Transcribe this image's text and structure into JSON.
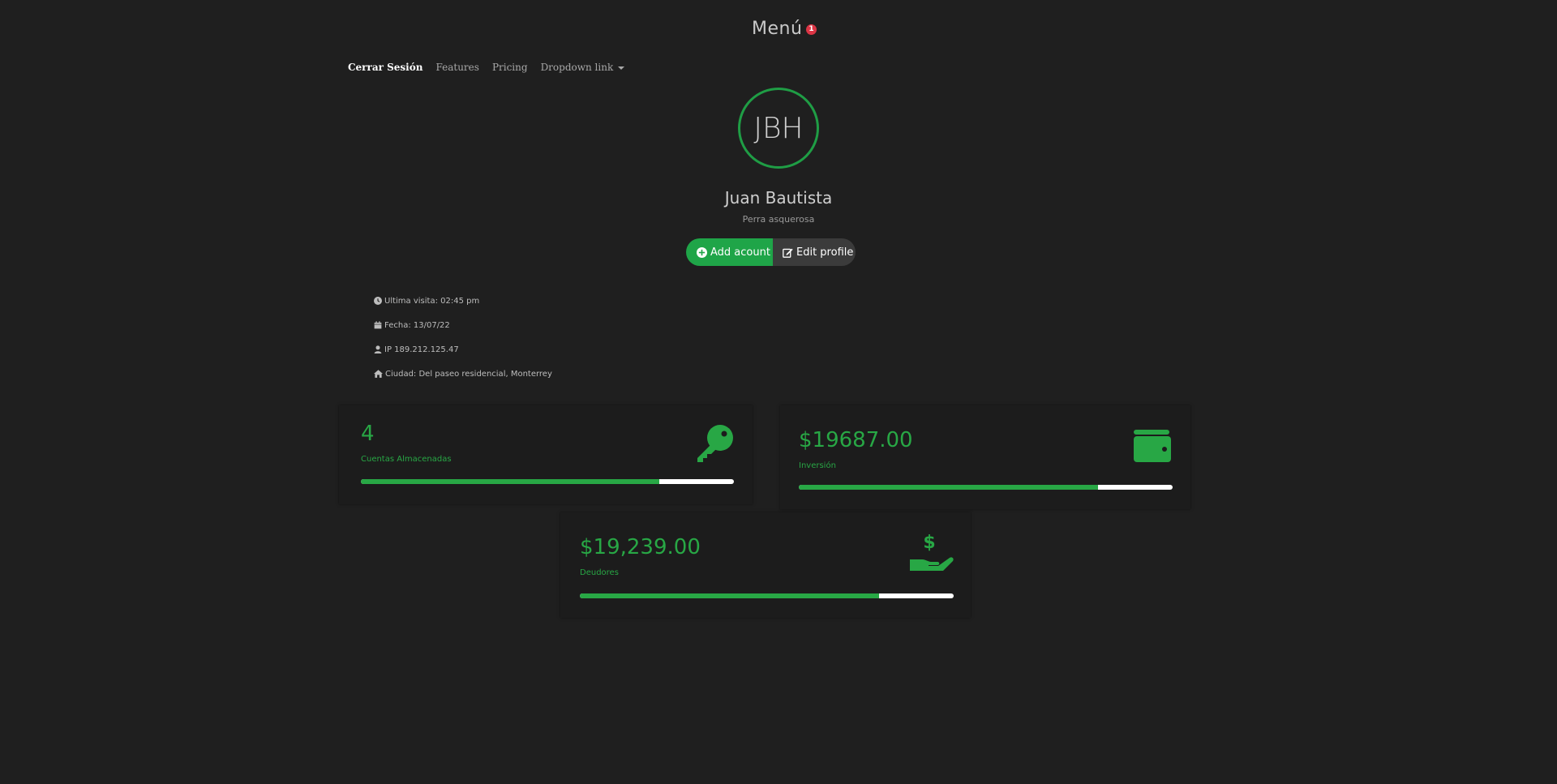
{
  "header": {
    "menu_title": "Menú",
    "notification_count": "1"
  },
  "nav": {
    "items": [
      {
        "label": "Cerrar Sesión"
      },
      {
        "label": "Features"
      },
      {
        "label": "Pricing"
      },
      {
        "label": "Dropdown link"
      }
    ]
  },
  "profile": {
    "initials": "JBH",
    "name": "Juan Bautista",
    "subtitle": "Perra asquerosa",
    "add_label": "Add acount",
    "edit_label": "Edit profile"
  },
  "info": {
    "last_visit": "Ultima visita: 02:45 pm",
    "date": "Fecha: 13/07/22",
    "ip": "IP 189.212.125.47",
    "city": "Ciudad: Del paseo residencial, Monterrey"
  },
  "stats": [
    {
      "value": "4",
      "label": "Cuentas Almacenadas",
      "progress": 0.8,
      "icon": "key-icon"
    },
    {
      "value": "$19687.00",
      "label": "Inversión",
      "progress": 0.8,
      "icon": "wallet-icon"
    },
    {
      "value": "$19,239.00",
      "label": "Deudores",
      "progress": 0.8,
      "icon": "hand-dollar-icon"
    }
  ],
  "colors": {
    "accent": "#28a745",
    "background": "#1f1f1f",
    "badge": "#dc3545"
  }
}
